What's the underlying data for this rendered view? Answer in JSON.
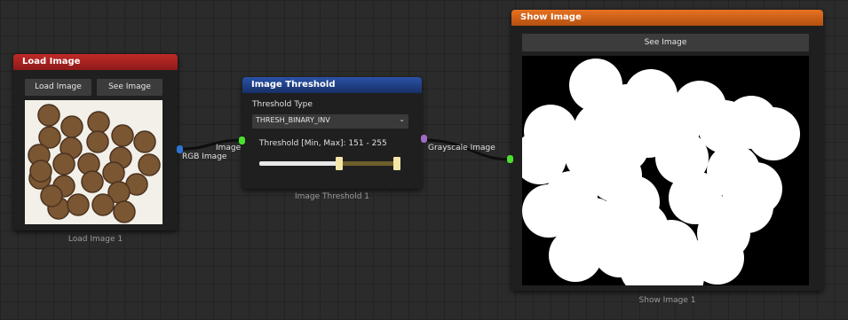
{
  "colors": {
    "load_header": "#a4201f",
    "threshold_header": "#1f3f82",
    "show_header": "#d7641a",
    "port_rgb": "#2b74d6",
    "port_green": "#4be02c",
    "port_gray": "#a06bc4"
  },
  "load_node": {
    "title": "Load Image",
    "load_button": "Load Image",
    "see_button": "See Image",
    "output_label": "RGB Image",
    "caption": "Load Image 1",
    "thumbnail_icon": "coins-photo"
  },
  "threshold_node": {
    "title": "Image Threshold",
    "input_label": "Image",
    "type_label": "Threshold Type",
    "type_value": "THRESH_BINARY_INV",
    "range_label": "Threshold [Min, Max]: 151 - 255",
    "range_min": 151,
    "range_max": 255,
    "output_label": "Grayscale Image",
    "caption": "Image Threshold 1"
  },
  "show_node": {
    "title": "Show Image",
    "see_button": "See Image",
    "caption": "Show Image 1",
    "preview_icon": "binary-threshold-preview"
  }
}
